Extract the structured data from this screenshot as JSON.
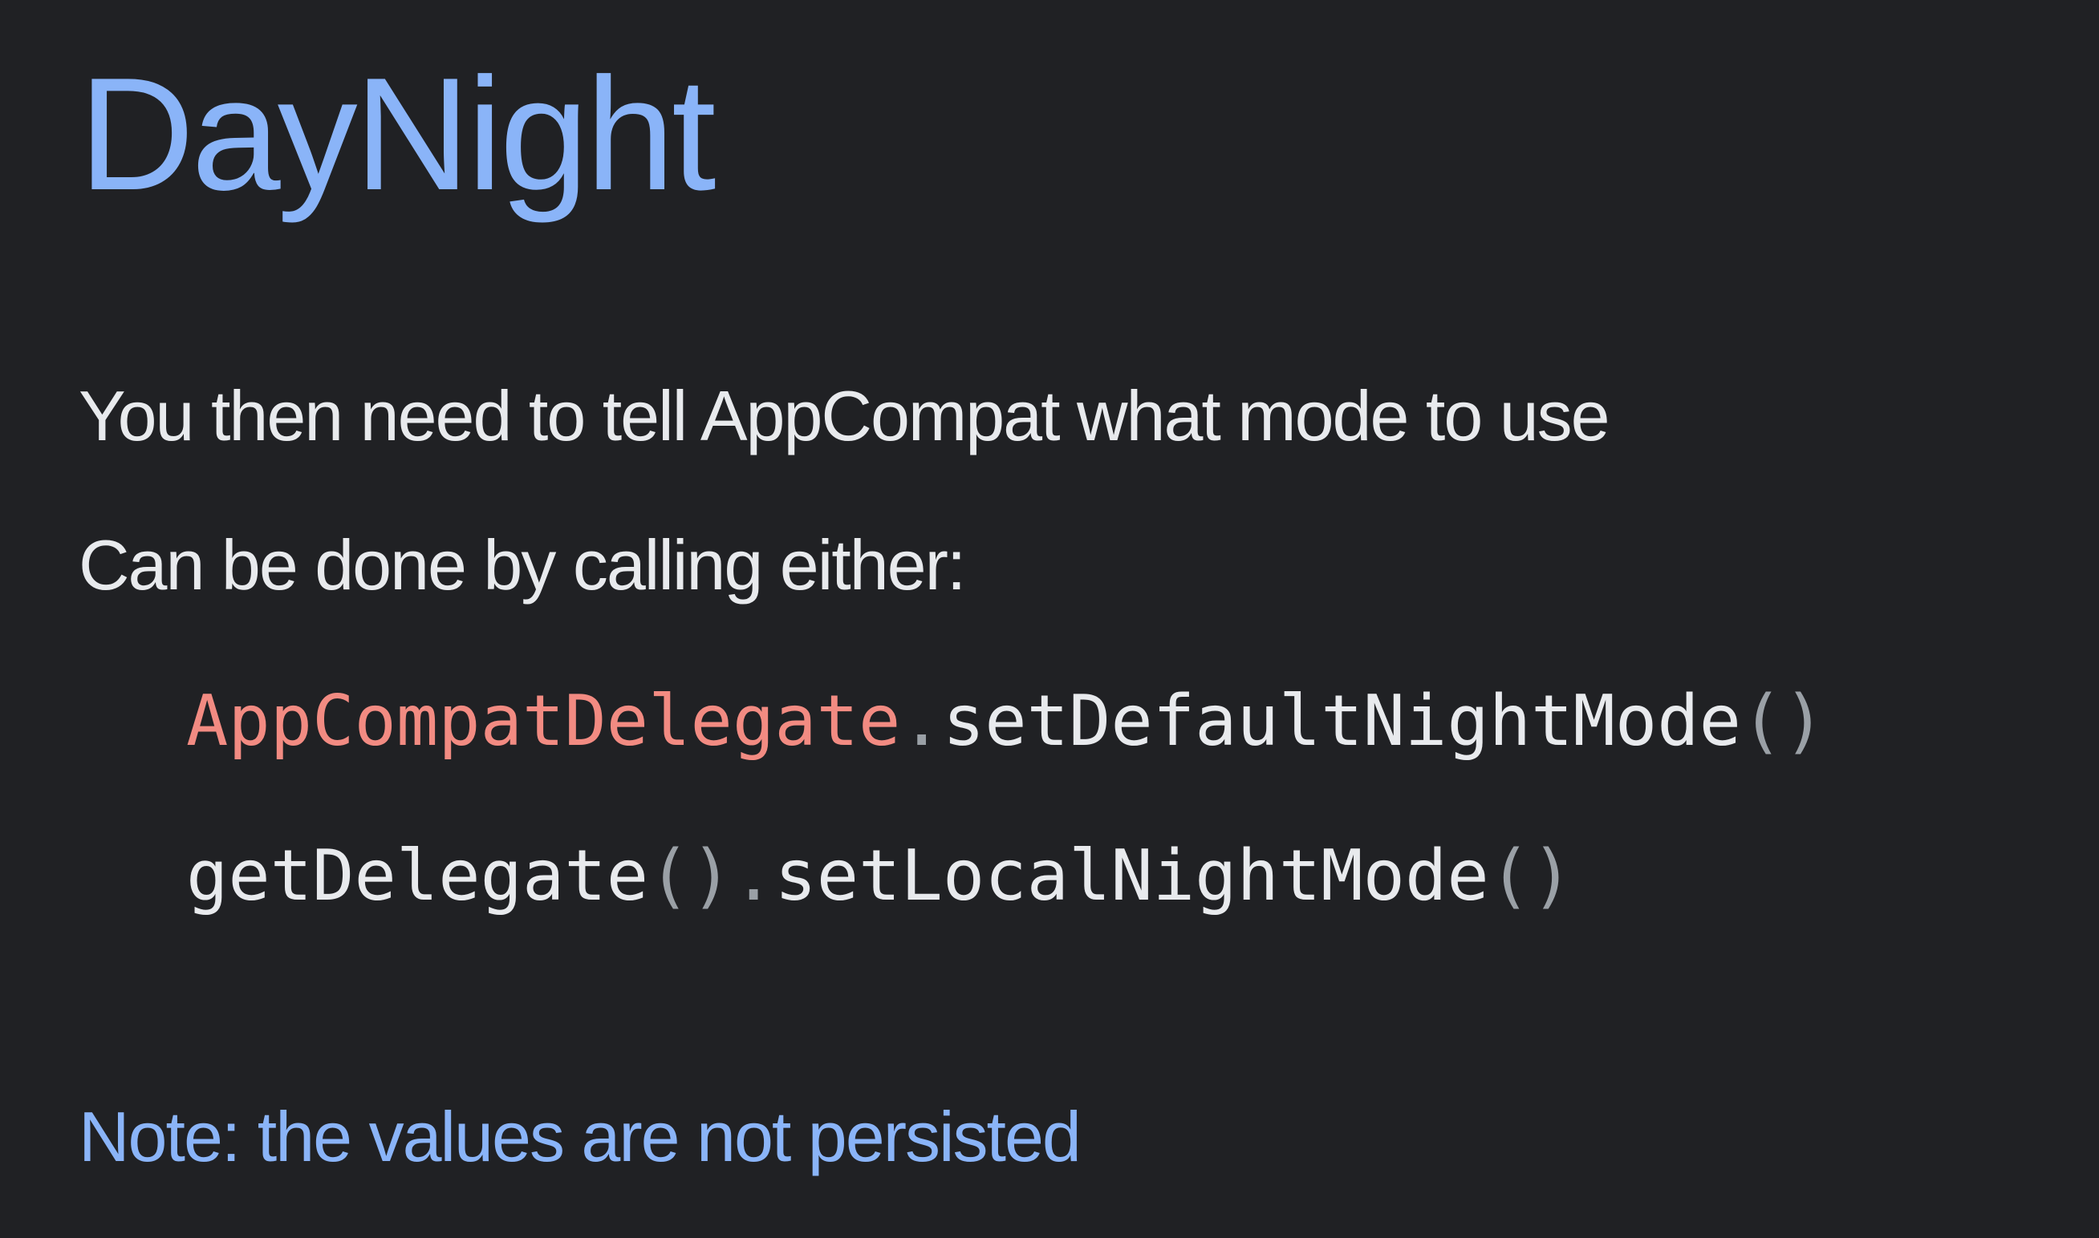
{
  "slide": {
    "title": "DayNight",
    "lines": [
      "You then need to tell AppCompat what mode to use",
      "Can be done by calling either:"
    ],
    "code": [
      {
        "class_name": "AppCompatDelegate",
        "dot": ".",
        "method": "setDefaultNightMode",
        "parens": "()"
      },
      {
        "method_a": "getDelegate",
        "parens_a": "()",
        "dot": ".",
        "method_b": "setLocalNightMode",
        "parens_b": "()"
      }
    ],
    "note": "Note: the values are not persisted"
  },
  "colors": {
    "background": "#202124",
    "title": "#8ab4f8",
    "text": "#e8eaed",
    "code_class": "#f28b82",
    "code_punctuation": "#9aa0a6",
    "note": "#8ab4f8"
  }
}
